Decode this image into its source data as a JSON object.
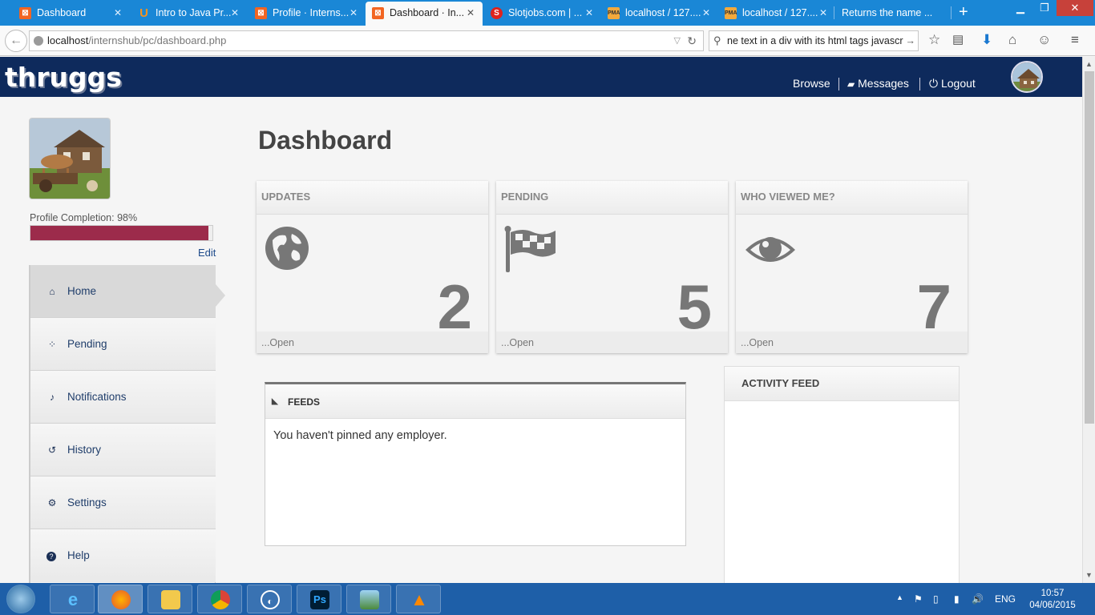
{
  "browser": {
    "tabs": [
      {
        "label": "Dashboard",
        "icon": "xampp-icon",
        "color": "#f26522"
      },
      {
        "label": "Intro to Java Pr...",
        "icon": "udacity-icon",
        "color": "#f7931e"
      },
      {
        "label": "Profile · Interns...",
        "icon": "xampp-icon",
        "color": "#f26522"
      },
      {
        "label": "Dashboard · In...",
        "icon": "xampp-icon",
        "color": "#f26522",
        "active": true
      },
      {
        "label": "Slotjobs.com | ...",
        "icon": "slotjobs-icon",
        "color": "#e0231c"
      },
      {
        "label": "localhost / 127....",
        "icon": "phpmyadmin-icon",
        "color": "#f3a93c"
      },
      {
        "label": "localhost / 127....",
        "icon": "phpmyadmin-icon",
        "color": "#f3a93c"
      },
      {
        "label": "Returns the name ...",
        "icon": "",
        "color": ""
      }
    ],
    "url": {
      "host": "localhost",
      "path": "/internshub/pc/dashboard.php"
    },
    "search_value": "ne text in a div with its html tags javascrip"
  },
  "site": {
    "logo": "thruggs",
    "nav": {
      "browse": "Browse",
      "messages": "Messages",
      "logout": "Logout"
    }
  },
  "sidebar": {
    "completion_label": "Profile Completion: 98%",
    "completion_value": 0.98,
    "edit": "Edit",
    "items": [
      {
        "label": "Home",
        "icon": "home-icon",
        "glyph": "⌂"
      },
      {
        "label": "Pending",
        "icon": "spinner-icon",
        "glyph": "⁘"
      },
      {
        "label": "Notifications",
        "icon": "bell-icon",
        "glyph": "♪"
      },
      {
        "label": "History",
        "icon": "history-icon",
        "glyph": "↺"
      },
      {
        "label": "Settings",
        "icon": "cogs-icon",
        "glyph": "⚙"
      },
      {
        "label": "Help",
        "icon": "question-icon",
        "glyph": "?"
      }
    ]
  },
  "main": {
    "title": "Dashboard",
    "cards": [
      {
        "title": "UPDATES",
        "count": "2",
        "footer": "...Open",
        "icon": "globe-icon"
      },
      {
        "title": "PENDING",
        "count": "5",
        "footer": "...Open",
        "icon": "flag-icon"
      },
      {
        "title": "WHO VIEWED ME?",
        "count": "7",
        "footer": "...Open",
        "icon": "eye-icon"
      }
    ],
    "feeds": {
      "title": "FEEDS",
      "message": "You haven't pinned any employer."
    },
    "activity": {
      "title": "ACTIVITY FEED"
    }
  },
  "tray": {
    "lang": "ENG",
    "time": "10:57",
    "date": "04/06/2015"
  }
}
